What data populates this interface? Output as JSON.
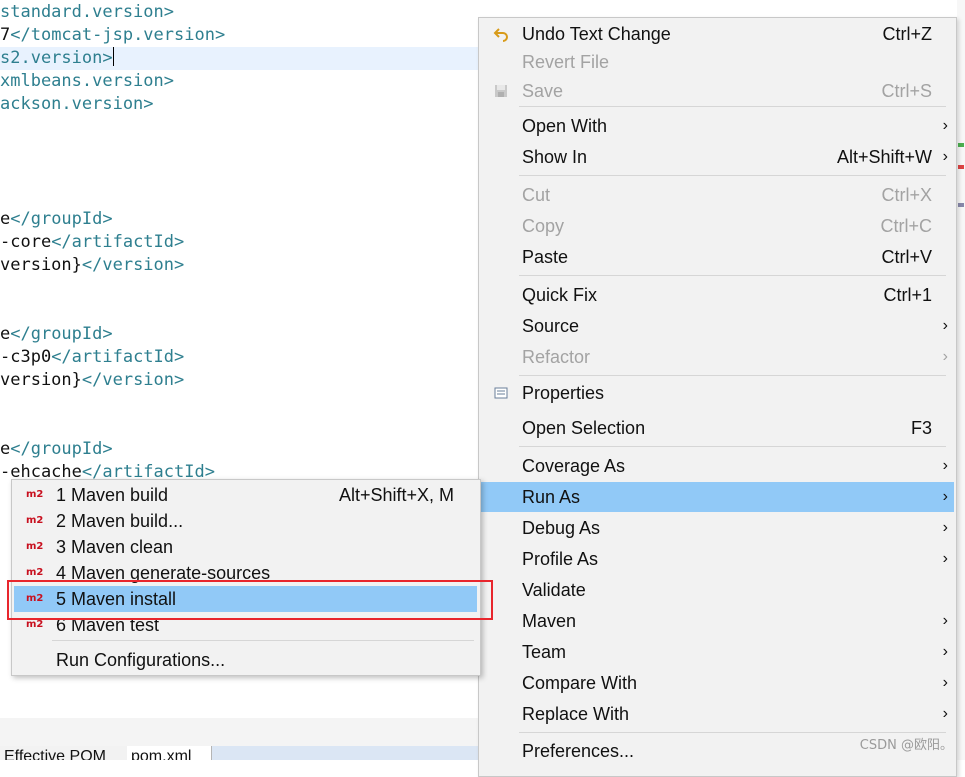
{
  "editor": {
    "lines": [
      {
        "tag_pre": "",
        "text": "standard.version>",
        "tag_post": ""
      },
      {
        "tag_pre": "",
        "text": "7",
        "tag_post": "</tomcat-jsp.version>"
      },
      {
        "tag_pre": "",
        "text": "s2.version>",
        "tag_post": ""
      },
      {
        "tag_pre": "",
        "text": "xmlbeans.version>",
        "tag_post": ""
      },
      {
        "tag_pre": "",
        "text": "ackson.version>",
        "tag_post": ""
      },
      {
        "tag_pre": "",
        "text": "e",
        "tag_post": "</groupId>"
      },
      {
        "tag_pre": "",
        "text": "-core",
        "tag_post": "</artifactId>"
      },
      {
        "tag_pre": "",
        "text": "version}",
        "tag_post": "</version>"
      },
      {
        "tag_pre": "",
        "text": "e",
        "tag_post": "</groupId>"
      },
      {
        "tag_pre": "",
        "text": "-c3p0",
        "tag_post": "</artifactId>"
      },
      {
        "tag_pre": "",
        "text": "version}",
        "tag_post": "</version>"
      },
      {
        "tag_pre": "",
        "text": "e",
        "tag_post": "</groupId>"
      },
      {
        "tag_pre": "",
        "text": "-ehcache",
        "tag_post": "</artifactId>"
      }
    ],
    "tabs": {
      "effective": "Effective POM",
      "pom": "pom.xml"
    }
  },
  "context_menu": {
    "items": [
      {
        "label": "Undo Text Change",
        "shortcut": "Ctrl+Z",
        "icon": "undo-icon"
      },
      {
        "label": "Revert File",
        "shortcut": "",
        "disabled": true
      },
      {
        "label": "Save",
        "shortcut": "Ctrl+S",
        "disabled": true,
        "icon": "save-icon"
      },
      {
        "label": "Open With",
        "submenu": true
      },
      {
        "label": "Show In",
        "shortcut": "Alt+Shift+W",
        "submenu": true
      },
      {
        "label": "Cut",
        "shortcut": "Ctrl+X",
        "disabled": true
      },
      {
        "label": "Copy",
        "shortcut": "Ctrl+C",
        "disabled": true
      },
      {
        "label": "Paste",
        "shortcut": "Ctrl+V"
      },
      {
        "label": "Quick Fix",
        "shortcut": "Ctrl+1"
      },
      {
        "label": "Source",
        "submenu": true
      },
      {
        "label": "Refactor",
        "submenu": true,
        "disabled": true
      },
      {
        "label": "Properties",
        "icon": "properties-icon"
      },
      {
        "label": "Open Selection",
        "shortcut": "F3"
      },
      {
        "label": "Coverage As",
        "submenu": true
      },
      {
        "label": "Run As",
        "submenu": true,
        "active": true
      },
      {
        "label": "Debug As",
        "submenu": true
      },
      {
        "label": "Profile As",
        "submenu": true
      },
      {
        "label": "Validate"
      },
      {
        "label": "Maven",
        "submenu": true
      },
      {
        "label": "Team",
        "submenu": true
      },
      {
        "label": "Compare With",
        "submenu": true
      },
      {
        "label": "Replace With",
        "submenu": true
      },
      {
        "label": "Preferences..."
      }
    ],
    "arrow_glyph": "›"
  },
  "run_as_submenu": {
    "icon_text": "m2",
    "items": [
      {
        "label": "1 Maven build",
        "shortcut": "Alt+Shift+X, M"
      },
      {
        "label": "2 Maven build...",
        "shortcut": ""
      },
      {
        "label": "3 Maven clean",
        "shortcut": ""
      },
      {
        "label": "4 Maven generate-sources",
        "shortcut": ""
      },
      {
        "label": "5 Maven install",
        "shortcut": "",
        "active": true
      },
      {
        "label": "6 Maven test",
        "shortcut": ""
      }
    ],
    "run_configurations": "Run Configurations..."
  },
  "watermark": "CSDN @欧阳。",
  "colors": {
    "highlight": "#91c9f7",
    "annotation": "#e8262d",
    "xml_tag": "#2e7f8f"
  }
}
